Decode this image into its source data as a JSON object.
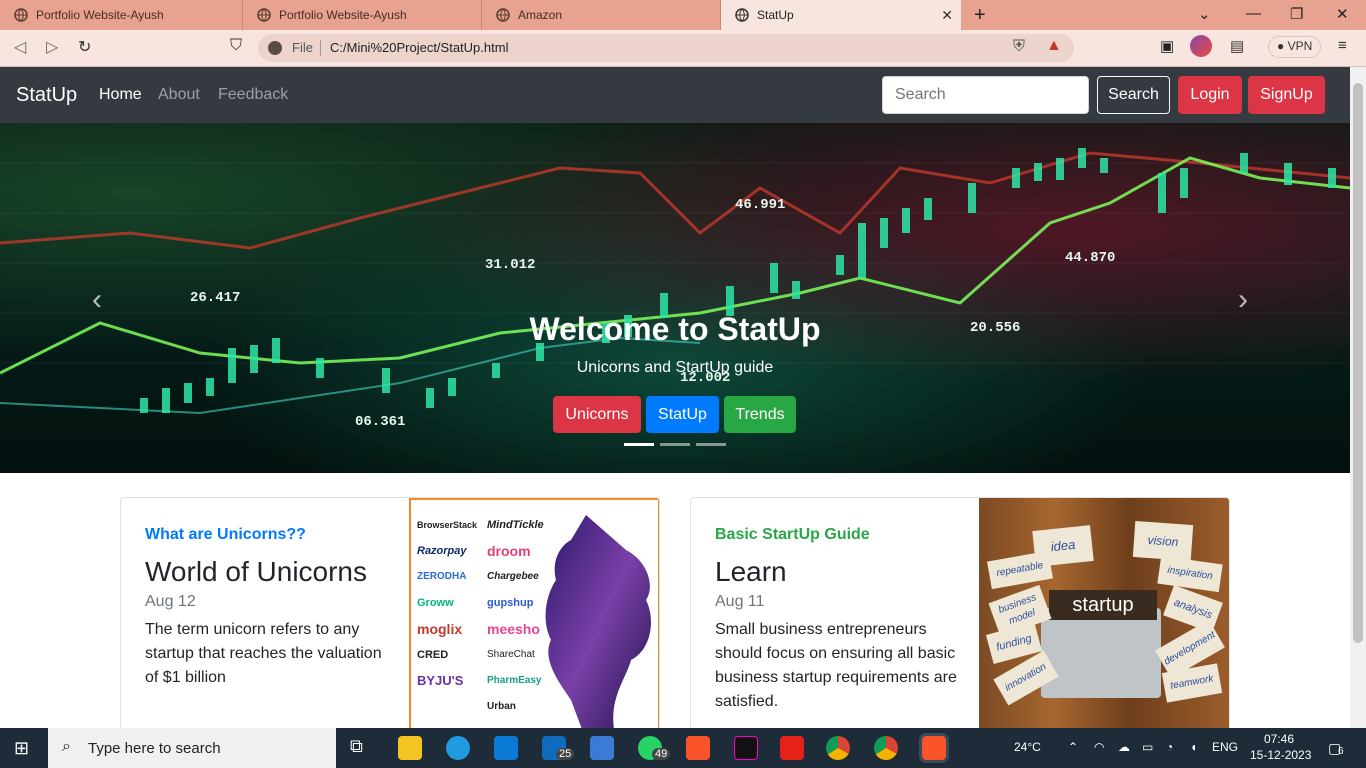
{
  "browser": {
    "tabs": [
      {
        "label": "Portfolio Website-Ayush"
      },
      {
        "label": "Portfolio Website-Ayush"
      },
      {
        "label": "Amazon"
      },
      {
        "label": "StatUp"
      }
    ],
    "address": {
      "scheme": "File",
      "url": "C:/Mini%20Project/StatUp.html"
    },
    "vpn_label": "VPN"
  },
  "navbar": {
    "brand": "StatUp",
    "links": [
      "Home",
      "About",
      "Feedback"
    ],
    "search_placeholder": "Search",
    "search_button": "Search",
    "login_button": "Login",
    "signup_button": "SignUp"
  },
  "hero": {
    "title": "Welcome to StatUp",
    "subtitle": "Unicorns and StartUp guide",
    "buttons": [
      {
        "label": "Unicorns",
        "color": "#dc3545"
      },
      {
        "label": "StatUp",
        "color": "#007bff"
      },
      {
        "label": "Trends",
        "color": "#28a745"
      }
    ],
    "numbers": [
      "46.991",
      "31.012",
      "26.417",
      "44.870",
      "20.556",
      "12.002",
      "06.361"
    ]
  },
  "cards": [
    {
      "category": "What are Unicorns??",
      "category_color": "#007bff",
      "title": "World of Unicorns",
      "date": "Aug 12",
      "description": "The term unicorn refers to any startup that reaches the valuation of $1 billion",
      "logos": [
        "BrowserStack",
        "MindTickle",
        "Razorpay",
        "droom",
        "ZERODHA",
        "Chargebee",
        "Groww",
        "gupshup",
        "moglix",
        "meesho",
        "CRED",
        "ShareChat",
        "BYJU'S",
        "PharmEasy",
        "Urban"
      ]
    },
    {
      "category": "Basic StartUp Guide",
      "category_color": "#28a745",
      "title": "Learn",
      "date": "Aug 11",
      "description": "Small business entrepreneurs should focus on ensuring all basic business startup requirements are satisfied.",
      "image_words": [
        "idea",
        "vision",
        "repeatable",
        "inspiration",
        "business model",
        "analysis",
        "funding",
        "development",
        "innovation",
        "teamwork",
        "startup"
      ]
    }
  ],
  "taskbar": {
    "search_placeholder": "Type here to search",
    "weather": "24°C",
    "language": "ENG",
    "time": "07:46",
    "date": "15-12-2023",
    "mail_badge": "25",
    "whatsapp_badge": "49",
    "notif_badge": "6"
  }
}
